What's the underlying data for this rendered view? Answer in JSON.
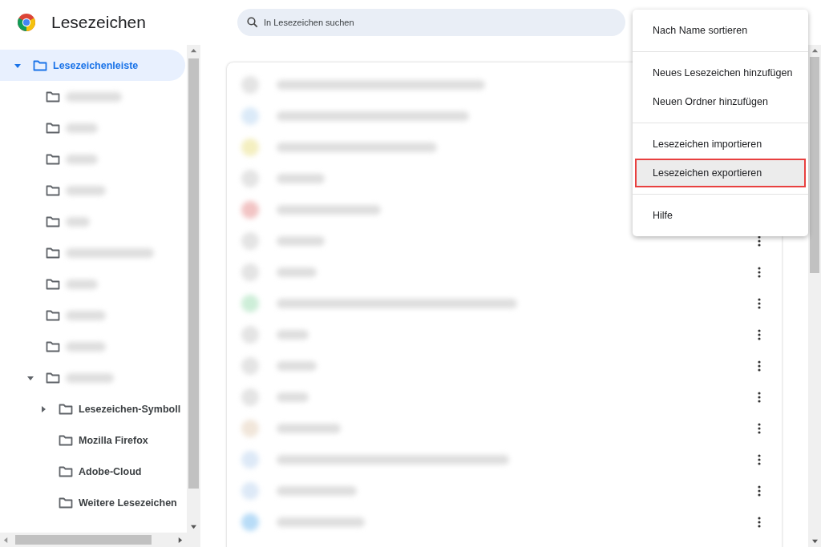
{
  "header": {
    "title": "Lesezeichen"
  },
  "search": {
    "placeholder": "In Lesezeichen suchen"
  },
  "sidebar": {
    "items": [
      {
        "kind": "folder",
        "label": "Lesezeichenleiste",
        "selected": true,
        "expanded": true,
        "children": [
          {
            "kind": "blurred",
            "selected": false
          },
          {
            "kind": "blurred",
            "selected": false
          },
          {
            "kind": "blurred",
            "selected": false
          },
          {
            "kind": "blurred",
            "selected": false
          },
          {
            "kind": "blurred",
            "selected": false
          },
          {
            "kind": "blurred",
            "selected": false
          },
          {
            "kind": "blurred",
            "selected": false
          },
          {
            "kind": "blurred",
            "selected": false
          },
          {
            "kind": "blurred",
            "selected": false
          },
          {
            "kind": "blurred",
            "selected": false,
            "expanded": true,
            "children": [
              {
                "kind": "folder",
                "label": "Lesezeichen-Symboll",
                "selected": false,
                "expanded": false
              },
              {
                "kind": "folder",
                "label": "Mozilla Firefox",
                "selected": false
              },
              {
                "kind": "folder",
                "label": "Adobe-Cloud",
                "selected": false
              },
              {
                "kind": "folder",
                "label": "Weitere Lesezeichen",
                "selected": false
              }
            ]
          }
        ]
      }
    ]
  },
  "bookmarks": [
    {
      "color": "#e4e4e4",
      "more_button": false
    },
    {
      "color": "#dbeaf8",
      "more_button": false
    },
    {
      "color": "#f4efc0",
      "more_button": false
    },
    {
      "color": "#e4e4e4",
      "more_button": false
    },
    {
      "color": "#f2c4c4",
      "more_button": false
    },
    {
      "color": "#e4e4e4",
      "more_button": true
    },
    {
      "color": "#e4e4e4",
      "more_button": true
    },
    {
      "color": "#cdeed8",
      "more_button": true
    },
    {
      "color": "#e4e4e4",
      "more_button": true
    },
    {
      "color": "#e4e4e4",
      "more_button": true
    },
    {
      "color": "#e4e4e4",
      "more_button": true
    },
    {
      "color": "#f1e6da",
      "more_button": true
    },
    {
      "color": "#dde9f7",
      "more_button": true
    },
    {
      "color": "#dde9f7",
      "more_button": true
    },
    {
      "color": "#b8dcf7",
      "more_button": true
    }
  ],
  "menu": {
    "groups": [
      [
        {
          "label": "Nach Name sortieren",
          "selected": false
        }
      ],
      [
        {
          "label": "Neues Lesezeichen hinzufügen",
          "selected": false
        },
        {
          "label": "Neuen Ordner hinzufügen",
          "selected": false
        }
      ],
      [
        {
          "label": "Lesezeichen importieren",
          "selected": false
        },
        {
          "label": "Lesezeichen exportieren",
          "selected": true
        }
      ],
      [
        {
          "label": "Hilfe",
          "selected": false
        }
      ]
    ]
  }
}
